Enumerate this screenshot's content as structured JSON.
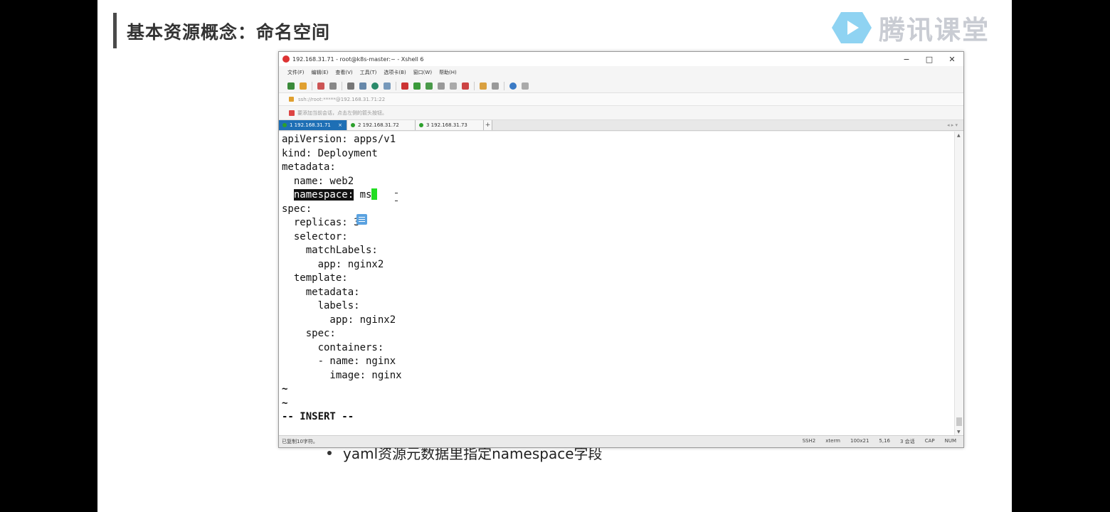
{
  "slide": {
    "title": "基本资源概念：命名空间",
    "logo_text": "腾讯课堂",
    "bullet": "yaml资源元数据里指定namespace字段"
  },
  "window": {
    "title": "192.168.31.71 - root@k8s-master:~ - Xshell 6",
    "controls": [
      "−",
      "□",
      "✕"
    ],
    "menu": [
      "文件(F)",
      "编辑(E)",
      "查看(V)",
      "工具(T)",
      "选项卡(B)",
      "窗口(W)",
      "帮助(H)"
    ],
    "address": "ssh://root:*****@192.168.31.71:22",
    "hint": "要添加当前会话，点击左侧的箭头按钮。",
    "tabs": [
      {
        "label": "1 192.168.31.71",
        "active": true
      },
      {
        "label": "2 192.168.31.72",
        "active": false
      },
      {
        "label": "3 192.168.31.73",
        "active": false
      }
    ],
    "tab_add": "+",
    "tab_nav": "◂ ▸ ▾"
  },
  "terminal": {
    "lines": [
      "apiVersion: apps/v1",
      "kind: Deployment",
      "metadata:",
      "  name: web2",
      "  namespace: ms",
      "spec:",
      "  replicas: 3",
      "  selector:",
      "    matchLabels:",
      "      app: nginx2",
      "  template:",
      "    metadata:",
      "      labels:",
      "        app: nginx2",
      "    spec:",
      "      containers:",
      "      - name: nginx",
      "        image: nginx",
      "~",
      "~",
      "-- INSERT --"
    ],
    "namespace_key": "namespace:",
    "namespace_value": " ms"
  },
  "statusbar": {
    "left": "已复制10字符。",
    "items": [
      "SSH2",
      "xterm",
      "100x21",
      "5,16",
      "3 会话",
      "CAP",
      "NUM"
    ]
  },
  "colors": {
    "tab_active": "#1e6fb5",
    "cursor": "#22dd22",
    "slide_bg": "#ffffff"
  }
}
